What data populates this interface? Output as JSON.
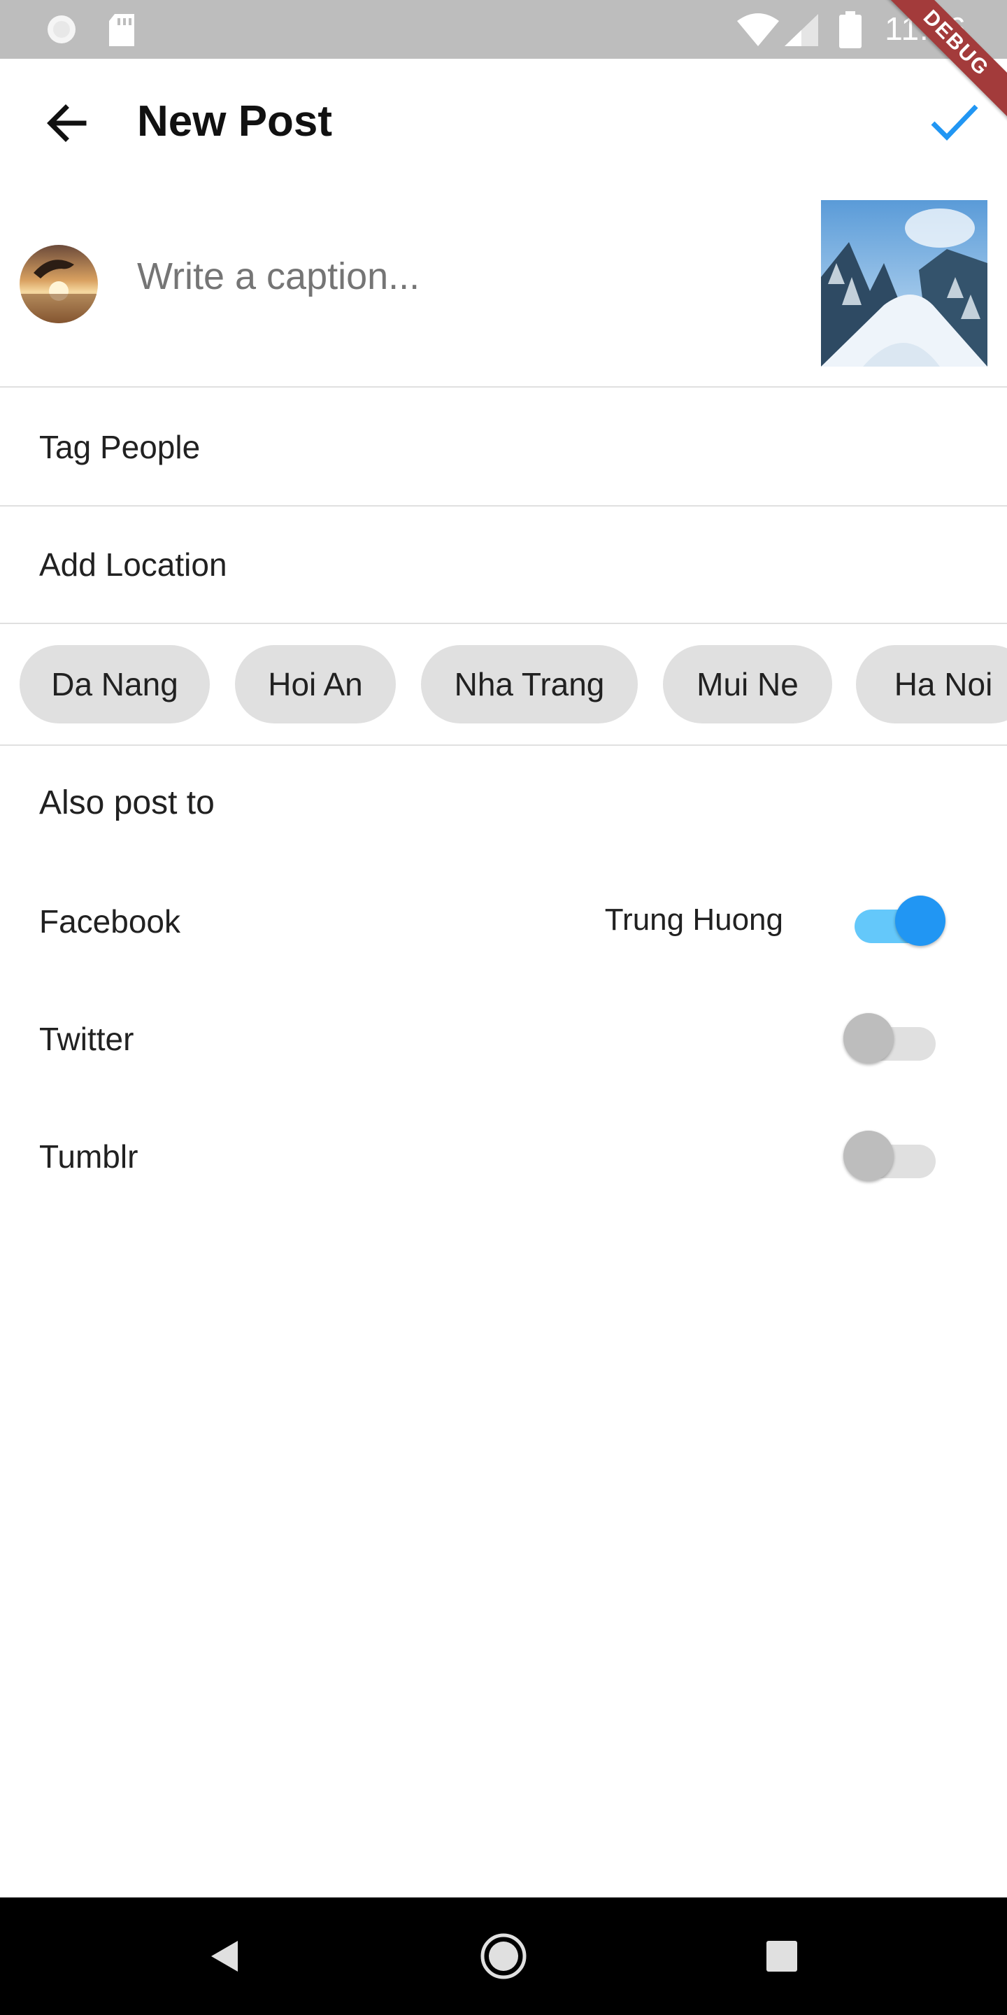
{
  "status_bar": {
    "time": "11:46",
    "icons": [
      "circle-icon",
      "sd-card-icon",
      "wifi-icon",
      "signal-icon",
      "battery-icon"
    ]
  },
  "debug_banner": "DEBUG",
  "app_bar": {
    "title": "New Post",
    "back_icon": "arrow-back-icon",
    "confirm_icon": "check-icon",
    "accent_color": "#2196f3"
  },
  "caption": {
    "placeholder": "Write a caption..."
  },
  "list": {
    "tag_people": "Tag People",
    "add_location": "Add Location"
  },
  "location_chips": [
    "Da Nang",
    "Hoi An",
    "Nha Trang",
    "Mui Ne",
    "Ha Noi"
  ],
  "share": {
    "title": "Also post to",
    "items": [
      {
        "label": "Facebook",
        "account": "Trung Huong",
        "enabled": true
      },
      {
        "label": "Twitter",
        "account": "",
        "enabled": false
      },
      {
        "label": "Tumblr",
        "account": "",
        "enabled": false
      }
    ]
  },
  "colors": {
    "switch_on_track": "#64c8fa",
    "switch_on_thumb": "#2196f3",
    "switch_off_track": "#e0e0e0",
    "switch_off_thumb": "#bdbdbd",
    "chip_bg": "#e0e0e0"
  },
  "nav_bar": {
    "icons": [
      "nav-back-icon",
      "nav-home-icon",
      "nav-recents-icon"
    ]
  }
}
